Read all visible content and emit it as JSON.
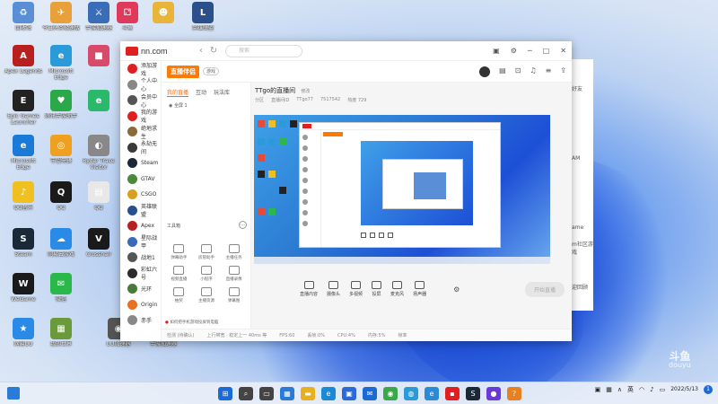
{
  "desktop": {
    "icons": [
      {
        "label": "回收站",
        "color": "#5a8fd8",
        "glyph": "♻"
      },
      {
        "label": "今日头条极速版",
        "color": "#e8a13a",
        "glyph": "✈"
      },
      {
        "label": "手游加速器",
        "color": "#3a6db8",
        "glyph": "⚔"
      },
      {
        "label": "斗鱼",
        "color": "#e03a5a",
        "glyph": "⚁"
      },
      {
        "label": "",
        "color": "#e8b53a",
        "glyph": "☻"
      },
      {
        "label": "英雄联盟",
        "color": "#2a4f8a",
        "glyph": "L"
      },
      {
        "label": "Apex Legends",
        "color": "#b82020",
        "glyph": "A"
      },
      {
        "label": "Microsoft Edge",
        "color": "#2a9ad8",
        "glyph": "e"
      },
      {
        "label": "",
        "color": "#d84a6a",
        "glyph": "■"
      },
      {
        "label": "Epic Games Launcher",
        "color": "#222",
        "glyph": "E"
      },
      {
        "label": "腾讯手游助手",
        "color": "#2aa84a",
        "glyph": "♥"
      },
      {
        "label": "",
        "color": "#2ab86a",
        "glyph": "e"
      },
      {
        "label": "Microsoft Edge",
        "color": "#1a7ad8",
        "glyph": "e"
      },
      {
        "label": "守望先锋",
        "color": "#f0a020",
        "glyph": "◎"
      },
      {
        "label": "Ryder Trace Visitor",
        "color": "#888",
        "glyph": "◐"
      },
      {
        "label": "QQ音乐",
        "color": "#f0c020",
        "glyph": "♪"
      },
      {
        "label": "QQ",
        "color": "#1a1a1a",
        "glyph": "Q"
      },
      {
        "label": "QQ",
        "color": "#e8e8e8",
        "glyph": "▤"
      },
      {
        "label": "Steam",
        "color": "#1b2838",
        "glyph": "S"
      },
      {
        "label": "网易云游戏",
        "color": "#2a8ae8",
        "glyph": "☁"
      },
      {
        "label": "Crosshair",
        "color": "#1a1a1a",
        "glyph": "V"
      },
      {
        "label": "WeGame",
        "color": "#1a1a1a",
        "glyph": "W"
      },
      {
        "label": "微信",
        "color": "#2ab84a",
        "glyph": "✉"
      },
      {
        "label": "网易UU",
        "color": "#2a8ae8",
        "glyph": "★"
      },
      {
        "label": "我的世界",
        "color": "#6a9a3a",
        "glyph": "▦"
      },
      {
        "label": "UU加速器",
        "color": "#555",
        "glyph": "◉"
      },
      {
        "label": "手游加速器",
        "color": "#3a3a3a",
        "glyph": "⊞"
      }
    ]
  },
  "window": {
    "brand": "nn.com",
    "search_placeholder": "搜索",
    "sidebar": [
      {
        "label": "添加游戏",
        "color": "#e02020"
      },
      {
        "label": "个人中心",
        "color": "#888"
      },
      {
        "label": "会员中心",
        "color": "#555"
      },
      {
        "label": "我的游戏",
        "color": "#e02020"
      },
      {
        "label": "绝地求生",
        "color": "#8a6a3a"
      },
      {
        "label": "永劫无间",
        "color": "#3a3a3a"
      },
      {
        "label": "Steam",
        "color": "#1b2838"
      },
      {
        "label": "GTAV",
        "color": "#4a8a3a"
      },
      {
        "label": "CSGO",
        "color": "#d8a020"
      },
      {
        "label": "英雄联盟",
        "color": "#2a4f8a"
      },
      {
        "label": "Apex",
        "color": "#b82020"
      },
      {
        "label": "星际战甲",
        "color": "#3a6ab8"
      },
      {
        "label": "战地1",
        "color": "#555"
      },
      {
        "label": "彩虹六号",
        "color": "#2a2a2a"
      },
      {
        "label": "光环",
        "color": "#4a7a3a"
      },
      {
        "label": "Origin",
        "color": "#e87020"
      },
      {
        "label": "赤手",
        "color": "#888"
      }
    ],
    "right_edge": [
      "好友",
      "",
      "AM",
      "ame",
      "m社区游戏",
      "",
      "迎回顾"
    ]
  },
  "obs": {
    "logo": "直播伴侣",
    "tag": "游戏",
    "tabs": [
      "我的直播",
      "互动",
      "玩法库"
    ],
    "scene_label": "全屏 1",
    "toolbox_title": "工具箱",
    "tools": [
      "弹幕助手",
      "房管助手",
      "主播任务",
      "视频直播",
      "小程序",
      "直播录像",
      "抽奖",
      "主播资源",
      "弹幕图"
    ],
    "room_title": "TTgo的直播间",
    "room_edit": "修改",
    "room_meta": [
      "分区",
      "直播间ID",
      "TTgo77",
      "7517542",
      "热度 729"
    ],
    "bottom_buttons": [
      "直播内容",
      "摄像头",
      "多视频",
      "投屏",
      "麦克风",
      "扬声器"
    ],
    "start_label": "开始直播",
    "notice": "如何把手机游戏投屏到电脑",
    "status": [
      "检测 (待确认)",
      "上行带宽 · 稳定上一 40ms 等",
      "FPS:60",
      "丢帧:0%",
      "CPU:4%",
      "内存:5%",
      "帧率"
    ]
  },
  "taskbar": {
    "icons": [
      {
        "name": "windows-start-icon",
        "color": "#1a6ad8",
        "glyph": "⊞"
      },
      {
        "name": "search-icon",
        "color": "#444",
        "glyph": "⌕"
      },
      {
        "name": "task-view-icon",
        "color": "#444",
        "glyph": "▭"
      },
      {
        "name": "widgets-icon",
        "color": "#2a7ad8",
        "glyph": "▦"
      },
      {
        "name": "file-explorer-icon",
        "color": "#e8b020",
        "glyph": "▬"
      },
      {
        "name": "edge-icon",
        "color": "#1a8ad8",
        "glyph": "e"
      },
      {
        "name": "store-icon",
        "color": "#2a6ad8",
        "glyph": "▣"
      },
      {
        "name": "mail-icon",
        "color": "#1a6ad8",
        "glyph": "✉"
      },
      {
        "name": "chrome-icon",
        "color": "#3aa84a",
        "glyph": "◉"
      },
      {
        "name": "browser-icon",
        "color": "#2a9ad8",
        "glyph": "◍"
      },
      {
        "name": "edge-alt-icon",
        "color": "#2a8ad8",
        "glyph": "e"
      },
      {
        "name": "nn-icon",
        "color": "#e02020",
        "glyph": "▪"
      },
      {
        "name": "steam-icon",
        "color": "#1b2838",
        "glyph": "S"
      },
      {
        "name": "obs-icon",
        "color": "#6a3ad8",
        "glyph": "●"
      },
      {
        "name": "game-icon",
        "color": "#e88020",
        "glyph": "?"
      }
    ],
    "lang": "英",
    "time": "",
    "date": "2022/5/13"
  },
  "watermark": [
    "斗鱼",
    "douyu"
  ]
}
